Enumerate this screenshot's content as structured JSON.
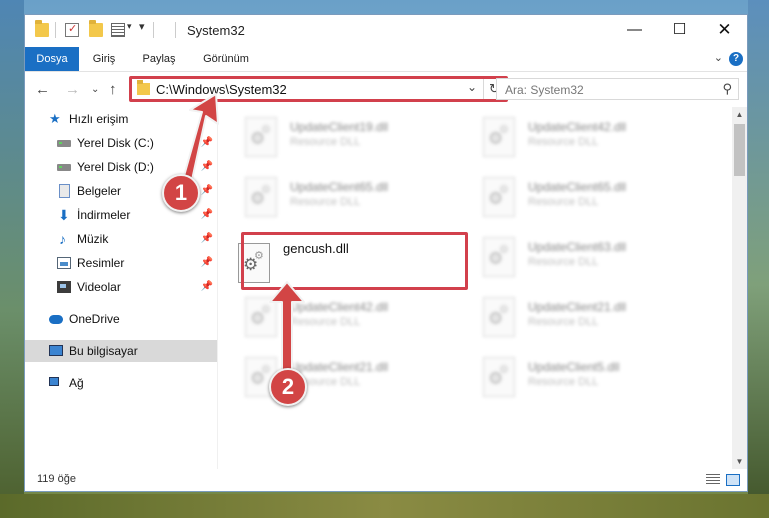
{
  "window": {
    "title": "System32"
  },
  "ribbon": {
    "tabs": [
      "Dosya",
      "Giriş",
      "Paylaş",
      "Görünüm"
    ],
    "help": "?"
  },
  "nav": {
    "address": "C:\\Windows\\System32",
    "search_placeholder": "Ara: System32"
  },
  "sidebar": {
    "items": [
      {
        "label": "Hızlı erişim"
      },
      {
        "label": "Yerel Disk (C:)"
      },
      {
        "label": "Yerel Disk (D:)"
      },
      {
        "label": "Belgeler"
      },
      {
        "label": "İndirmeler"
      },
      {
        "label": "Müzik"
      },
      {
        "label": "Resimler"
      },
      {
        "label": "Videolar"
      },
      {
        "label": "OneDrive"
      },
      {
        "label": "Bu bilgisayar"
      },
      {
        "label": "Ağ"
      }
    ]
  },
  "files": [
    {
      "name": "UpdateClient19.dll",
      "type": "Resource DLL"
    },
    {
      "name": "UpdateClient42.dll",
      "type": "Resource DLL"
    },
    {
      "name": "UpdateClient65.dll",
      "type": "Resource DLL"
    },
    {
      "name": "UpdateClient65.dll",
      "type": "Resource DLL"
    },
    {
      "name": "gencush.dll",
      "type": ""
    },
    {
      "name": "UpdateClient63.dll",
      "type": "Resource DLL"
    },
    {
      "name": "UpdateClient42.dll",
      "type": "Resource DLL"
    },
    {
      "name": "UpdateClient21.dll",
      "type": "Resource DLL"
    },
    {
      "name": "UpdateClient21.dll",
      "type": "Resource DLL"
    },
    {
      "name": "UpdateClient5.dll",
      "type": "Resource DLL"
    }
  ],
  "status": {
    "item_count": "119 öğe"
  },
  "callouts": {
    "one": "1",
    "two": "2"
  },
  "colors": {
    "accent": "#1a6fc4",
    "highlight": "#d2404c"
  }
}
